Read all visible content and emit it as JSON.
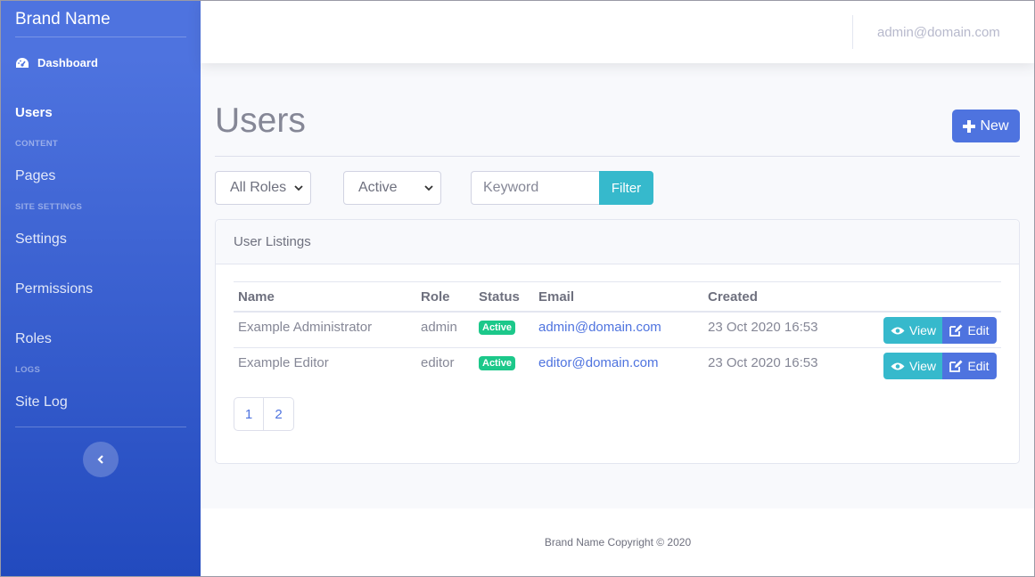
{
  "sidebar": {
    "brand": "Brand Name",
    "dashboard_label": "Dashboard",
    "items": [
      {
        "label": "Users"
      },
      {
        "heading": "CONTENT"
      },
      {
        "label": "Pages"
      },
      {
        "heading": "SITE SETTINGS"
      },
      {
        "label": "Settings"
      },
      {
        "label": "Permissions"
      },
      {
        "label": "Roles"
      },
      {
        "heading": "LOGS"
      },
      {
        "label": "Site Log"
      }
    ],
    "toggle_icon": "chevron-left-icon"
  },
  "topbar": {
    "user_email": "admin@domain.com"
  },
  "main": {
    "title": "Users",
    "new_button": "New",
    "filters": {
      "role_selected": "All Roles",
      "status_selected": "Active",
      "keyword_placeholder": "Keyword",
      "filter_button": "Filter"
    },
    "card_title": "User Listings",
    "table": {
      "columns": [
        "Name",
        "Role",
        "Status",
        "Email",
        "Created"
      ],
      "rows": [
        {
          "name": "Example Administrator",
          "role": "admin",
          "status": "Active",
          "email": "admin@domain.com",
          "created": "23 Oct 2020 16:53"
        },
        {
          "name": "Example Editor",
          "role": "editor",
          "status": "Active",
          "email": "editor@domain.com",
          "created": "23 Oct 2020 16:53"
        }
      ],
      "view_label": "View",
      "edit_label": "Edit"
    },
    "pagination": [
      "1",
      "2"
    ]
  },
  "footer": {
    "text": "Brand Name Copyright © 2020"
  },
  "colors": {
    "primary": "#4e73df",
    "info": "#36b9cc",
    "success": "#1cc88a"
  }
}
